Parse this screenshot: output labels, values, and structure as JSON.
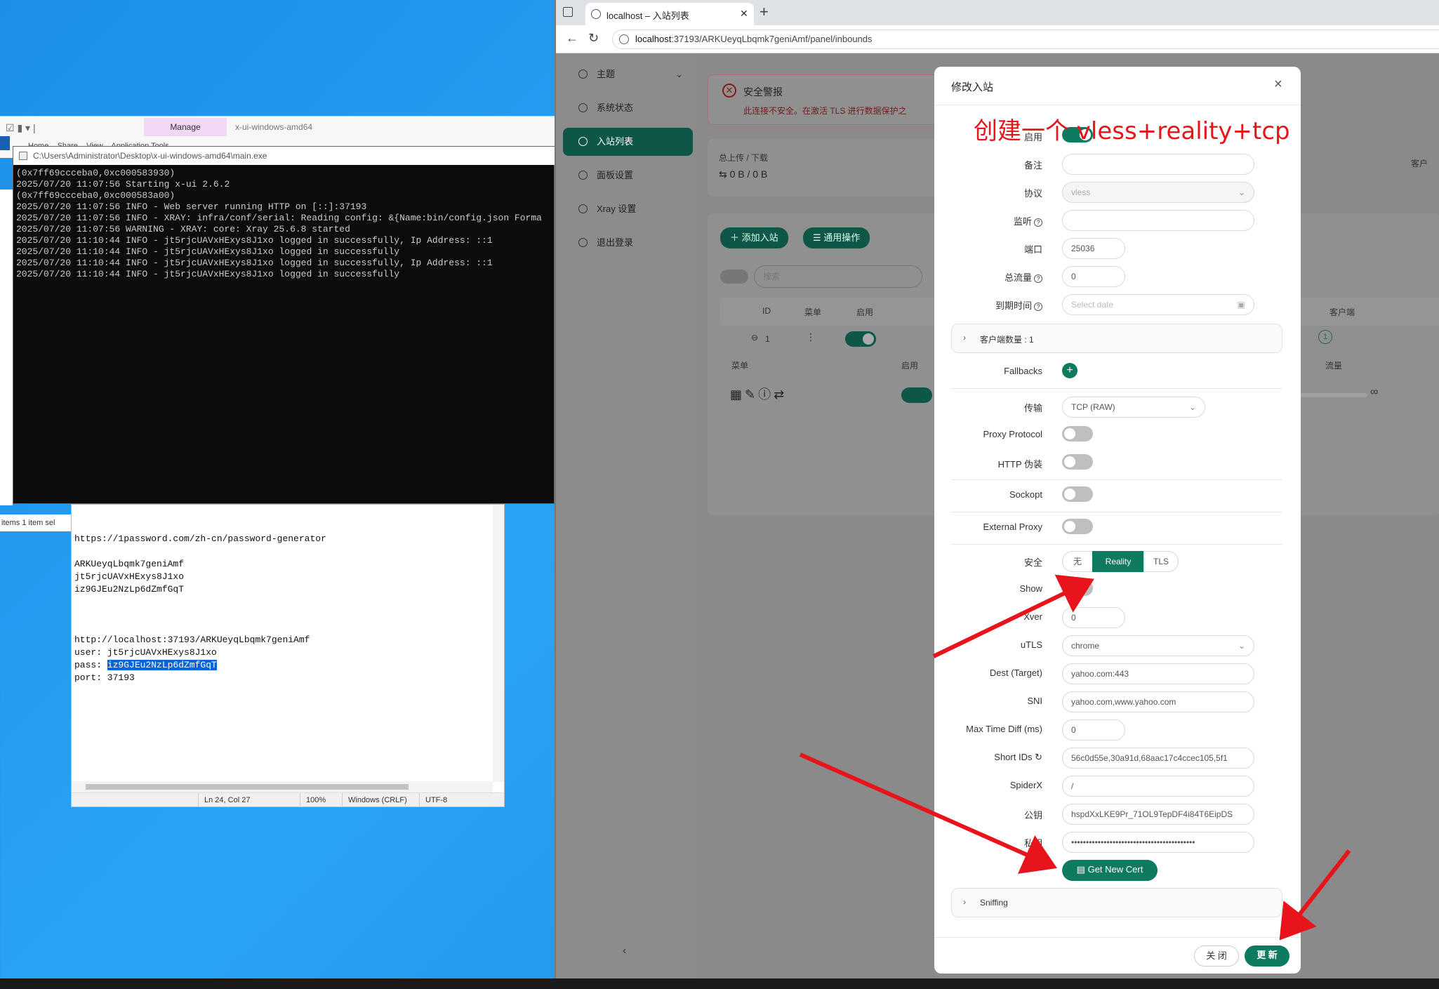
{
  "explorer": {
    "manage_tab": "Manage",
    "window_title": "x-ui-windows-amd64",
    "ribbon_tabs": "Home    Share    View    Application Tools"
  },
  "console": {
    "title": "C:\\Users\\Administrator\\Desktop\\x-ui-windows-amd64\\main.exe",
    "lines": [
      "(0x7ff69ccceba0,0xc000583930)",
      "2025/07/20 11:07:56 Starting x-ui 2.6.2",
      "(0x7ff69ccceba0,0xc000583a00)",
      "2025/07/20 11:07:56 INFO - Web server running HTTP on [::]:37193",
      "2025/07/20 11:07:56 INFO - XRAY: infra/conf/serial: Reading config: &{Name:bin/config.json Forma",
      "2025/07/20 11:07:56 WARNING - XRAY: core: Xray 25.6.8 started",
      "2025/07/20 11:10:44 INFO - jt5rjcUAVxHExys8J1xo logged in successfully, Ip Address: ::1",
      "2025/07/20 11:10:44 INFO - jt5rjcUAVxHExys8J1xo logged in successfully",
      "2025/07/20 11:10:44 INFO - jt5rjcUAVxHExys8J1xo logged in successfully, Ip Address: ::1",
      "2025/07/20 11:10:44 INFO - jt5rjcUAVxHExys8J1xo logged in successfully"
    ]
  },
  "explorer_status": "items     1 item sel",
  "notepad": {
    "text_before": "https://1password.com/zh-cn/password-generator\n\nARKUeyqLbqmk7geniAmf\njt5rjcUAVxHExys8J1xo\niz9GJEu2NzLp6dZmfGqT\n\n\n\nhttp://localhost:37193/ARKUeyqLbqmk7geniAmf\nuser: jt5rjcUAVxHExys8J1xo\npass: ",
    "selected": "iz9GJEu2NzLp6dZmfGqT",
    "text_after": "\nport: 37193",
    "status_pos": "Ln 24, Col 27",
    "status_zoom": "100%",
    "status_eol": "Windows (CRLF)",
    "status_enc": "UTF-8"
  },
  "browser": {
    "tab_title": "localhost – 入站列表",
    "url_host": "localhost",
    "url_rest": ":37193/ARKUeyqLbqmk7geniAmf/panel/inbounds"
  },
  "sidebar": {
    "items": [
      {
        "label": "主题",
        "icon": "bulb-icon"
      },
      {
        "label": "系统状态",
        "icon": "dashboard-icon"
      },
      {
        "label": "入站列表",
        "icon": "user-icon"
      },
      {
        "label": "面板设置",
        "icon": "gear-icon"
      },
      {
        "label": "Xray 设置",
        "icon": "tool-icon"
      },
      {
        "label": "退出登录",
        "icon": "logout-icon"
      }
    ]
  },
  "main": {
    "alert_title": "安全警报",
    "alert_text": "此连接不安全。在激活 TLS 进行数据保护之",
    "traffic_label": "总上传 / 下载",
    "traffic_value": "⇆ 0 B / 0 B",
    "client_label": "客户",
    "add_inbound": "添加入站",
    "general_ops": "通用操作",
    "search_placeholder": "搜索",
    "col_id": "ID",
    "col_menu": "菜单",
    "col_enable": "启用",
    "col_clients": "客户端",
    "row_id": "1",
    "sub_menu": "菜单",
    "sub_enable": "启用",
    "sub_traffic": "流量",
    "row_client_count": "1",
    "infinity": "∞"
  },
  "modal": {
    "title": "修改入站",
    "annotation": "创建一个 vless+reality+tcp",
    "fields": {
      "enable": "启用",
      "remark": "备注",
      "protocol": "协议",
      "protocol_value": "vless",
      "listen": "监听",
      "port": "端口",
      "port_value": "25036",
      "total_traffic": "总流量",
      "total_value": "0",
      "expiry": "到期时间",
      "expiry_placeholder": "Select date",
      "clients_count": "客户端数量 : 1",
      "fallbacks": "Fallbacks",
      "transport": "传输",
      "transport_value": "TCP (RAW)",
      "proxy_protocol": "Proxy Protocol",
      "http_camouflage": "HTTP 伪装",
      "sockopt": "Sockopt",
      "external_proxy": "External Proxy",
      "security": "安全",
      "sec_none": "无",
      "sec_reality": "Reality",
      "sec_tls": "TLS",
      "show": "Show",
      "xver": "Xver",
      "xver_value": "0",
      "utls": "uTLS",
      "utls_value": "chrome",
      "dest": "Dest (Target)",
      "dest_value": "yahoo.com:443",
      "sni": "SNI",
      "sni_value": "yahoo.com,www.yahoo.com",
      "max_time_diff": "Max Time Diff (ms)",
      "max_time_value": "0",
      "short_ids": "Short IDs",
      "short_ids_value": "56c0d55e,30a91d,68aac17c4ccec105,5f1",
      "spiderx": "SpiderX",
      "spiderx_value": "/",
      "public_key": "公钥",
      "public_key_value": "hspdXxLKE9Pr_71OL9TepDF4i84T6EipDS",
      "private_key": "私钥",
      "private_key_value": "••••••••••••••••••••••••••••••••••••••••••",
      "get_new_cert": "Get New Cert",
      "sniffing": "Sniffing"
    },
    "btn_close": "关 闭",
    "btn_update": "更 新"
  },
  "colors": {
    "accent": "#0e7a5f",
    "annotation": "#e8141b"
  }
}
